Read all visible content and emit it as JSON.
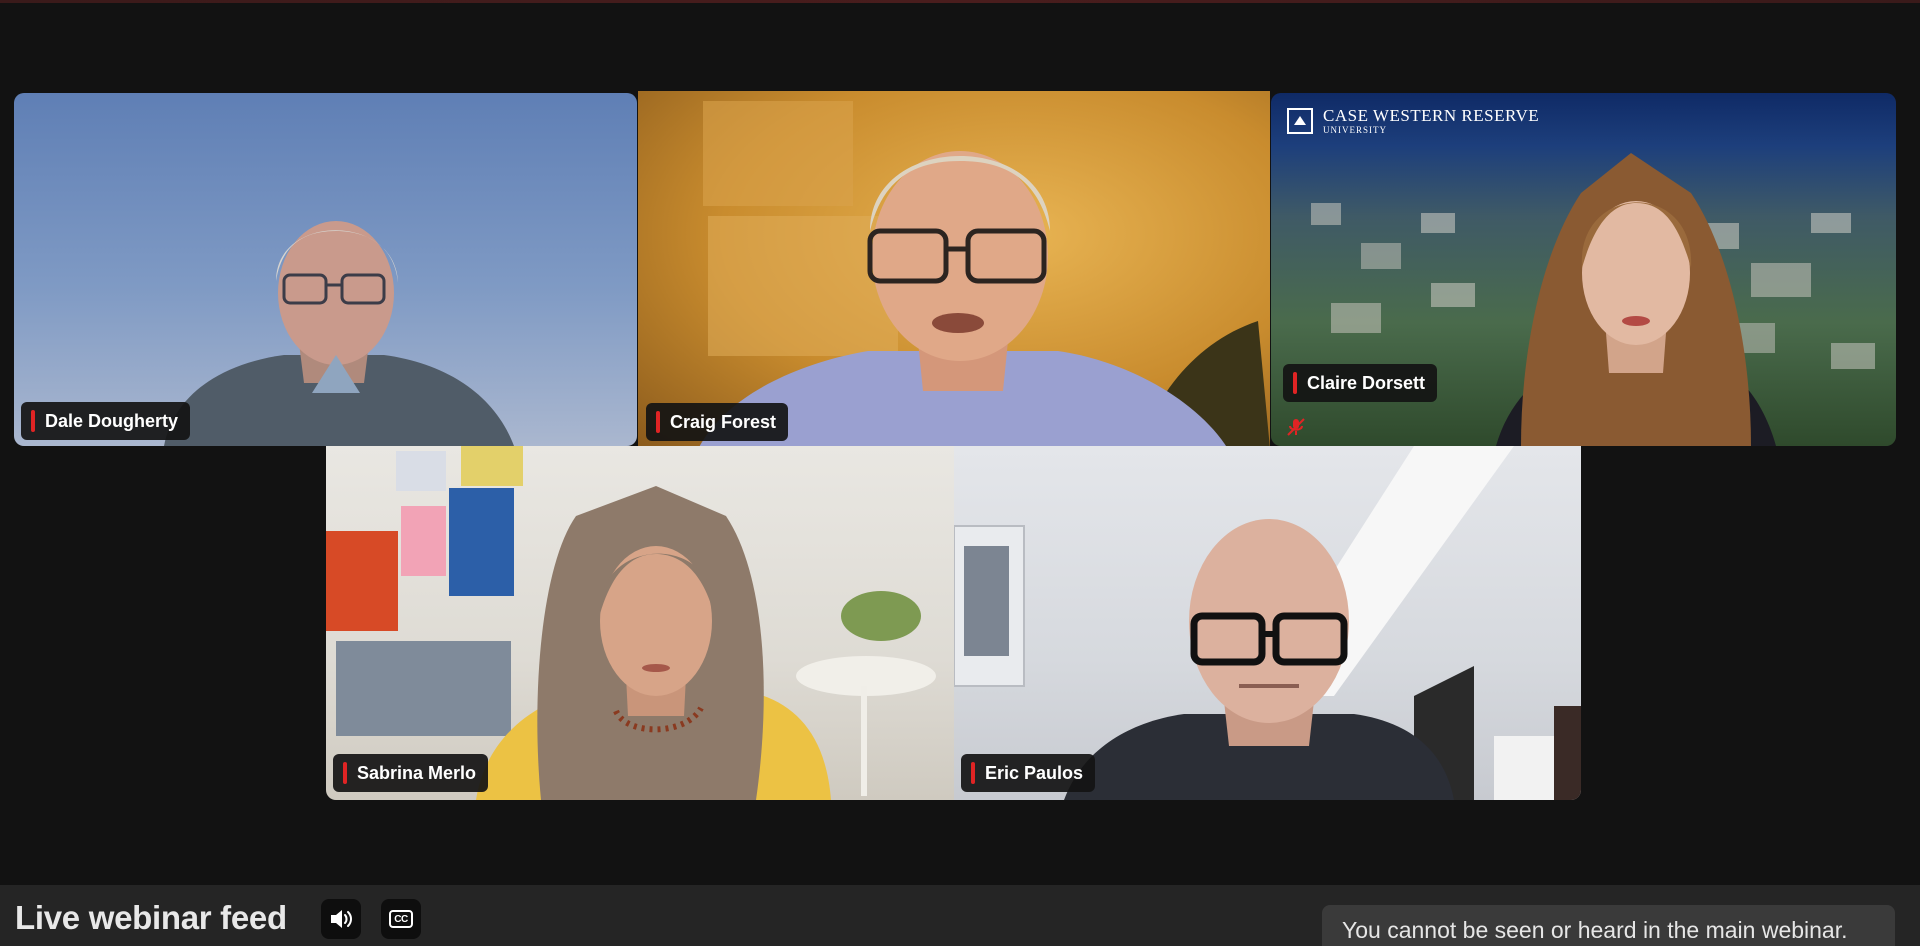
{
  "participants": [
    {
      "id": "dale",
      "name": "Dale Dougherty"
    },
    {
      "id": "craig",
      "name": "Craig Forest",
      "active_speaker": true
    },
    {
      "id": "claire",
      "name": "Claire Dorsett",
      "muted": true
    },
    {
      "id": "sabrina",
      "name": "Sabrina Merlo"
    },
    {
      "id": "eric",
      "name": "Eric Paulos"
    }
  ],
  "claire_background": {
    "brand_line1": "CASE WESTERN RESERVE",
    "brand_line2": "UNIVERSITY"
  },
  "bottom_bar": {
    "title": "Live webinar feed",
    "audio_button": {
      "icon": "speaker-icon"
    },
    "captions_button": {
      "icon": "closed-captions-icon",
      "label": "CC"
    },
    "notice": "You cannot be seen or heard in the main webinar."
  },
  "colors": {
    "active_speaker_border": "#34c759",
    "name_tag_indicator": "#e02424",
    "background": "#121212"
  }
}
